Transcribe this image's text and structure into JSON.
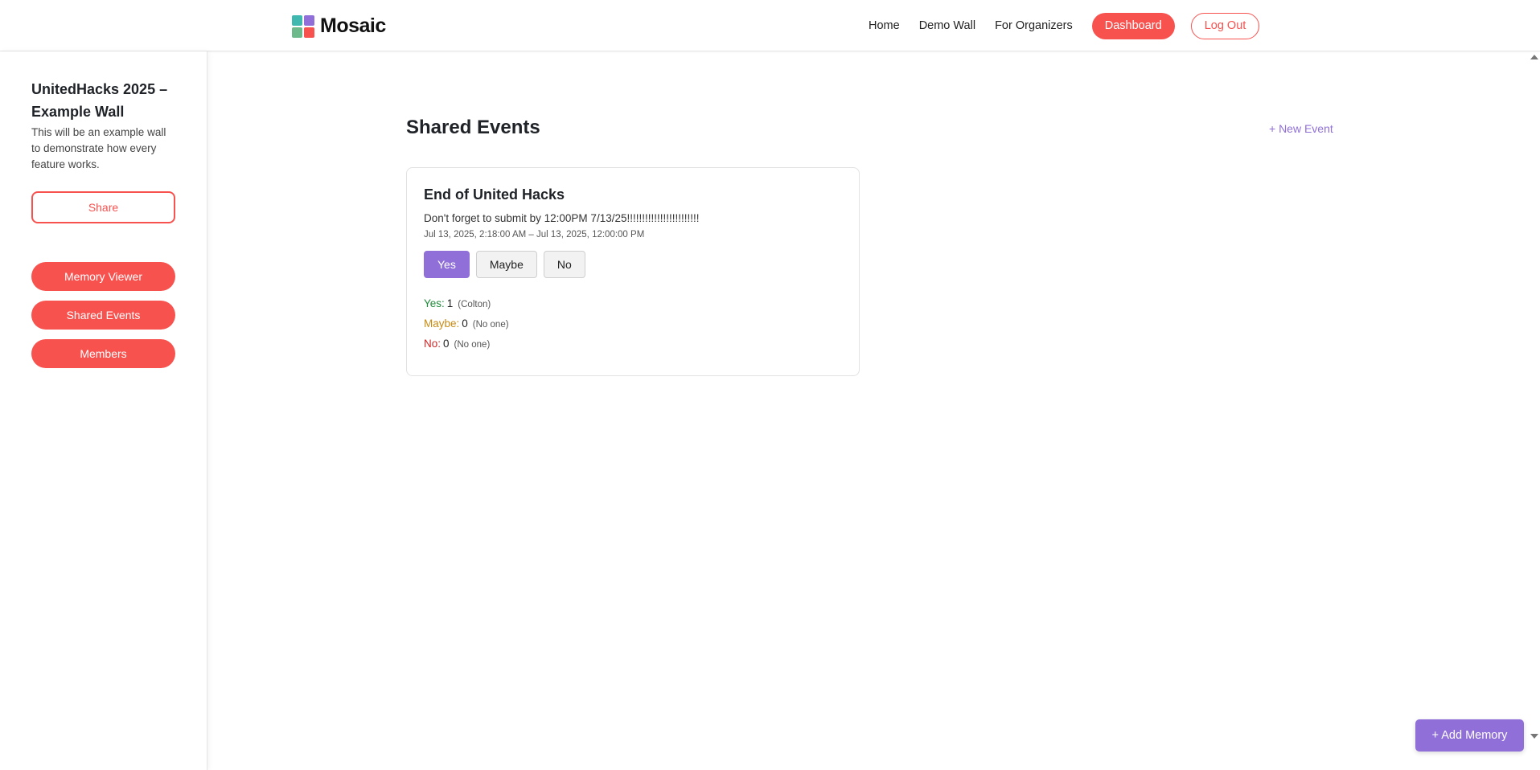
{
  "header": {
    "brand": "Mosaic",
    "logo_colors": [
      "#3fb8b0",
      "#9070d8",
      "#6cb98c",
      "#f8524f"
    ],
    "nav": [
      "Home",
      "Demo Wall",
      "For Organizers"
    ],
    "dashboard_label": "Dashboard",
    "logout_label": "Log Out"
  },
  "sidebar": {
    "wall_title": "UnitedHacks 2025 – Example Wall",
    "wall_description": "This will be an example wall to demonstrate how every feature works.",
    "share_label": "Share",
    "items": [
      "Memory Viewer",
      "Shared Events",
      "Members"
    ]
  },
  "main": {
    "title": "Shared Events",
    "new_event_label": "+ New Event",
    "events": [
      {
        "title": "End of United Hacks",
        "description": "Don't forget to submit by 12:00PM 7/13/25!!!!!!!!!!!!!!!!!!!!!!!!",
        "time": "Jul 13, 2025, 2:18:00 AM – Jul 13, 2025, 12:00:00 PM",
        "rsvp": [
          "Yes",
          "Maybe",
          "No"
        ],
        "selected_rsvp": "Yes",
        "tallies": [
          {
            "label": "Yes:",
            "count": "1",
            "names": "(Colton)"
          },
          {
            "label": "Maybe:",
            "count": "0",
            "names": "(No one)"
          },
          {
            "label": "No:",
            "count": "0",
            "names": "(No one)"
          }
        ]
      }
    ]
  },
  "add_memory_label": "+ Add Memory",
  "colors": {
    "accent_red": "#f8524f",
    "accent_purple": "#9070d8",
    "yes_green": "#1f8a3a",
    "maybe_orange": "#c98a12",
    "no_red": "#d12626"
  }
}
